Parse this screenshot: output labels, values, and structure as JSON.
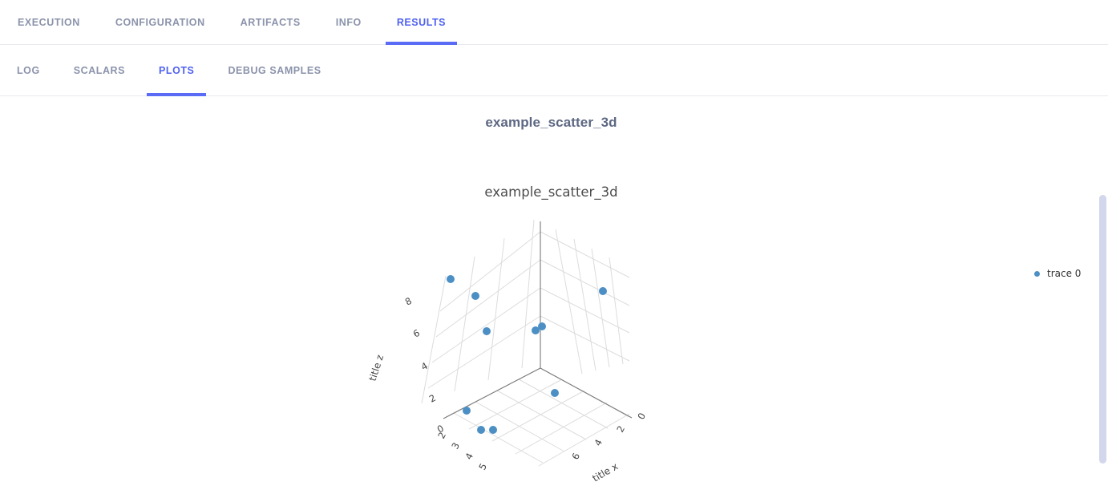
{
  "primary_tabs": [
    {
      "label": "EXECUTION",
      "active": false
    },
    {
      "label": "CONFIGURATION",
      "active": false
    },
    {
      "label": "ARTIFACTS",
      "active": false
    },
    {
      "label": "INFO",
      "active": false
    },
    {
      "label": "RESULTS",
      "active": true
    }
  ],
  "secondary_tabs": [
    {
      "label": "LOG",
      "active": false
    },
    {
      "label": "SCALARS",
      "active": false
    },
    {
      "label": "PLOTS",
      "active": true
    },
    {
      "label": "DEBUG SAMPLES",
      "active": false
    }
  ],
  "card": {
    "title": "example_scatter_3d"
  },
  "colors": {
    "accent": "#5a6cf5",
    "accent_text": "#4f61f0",
    "inactive_text": "#8b93ab",
    "card_title": "#5d6883",
    "marker": "#4b8fc4",
    "grid": "#d8d8d8",
    "axis_line": "#8d8d8d",
    "scrollbar_thumb": "#d2d7ec"
  },
  "chart_data": {
    "type": "scatter",
    "projection": "3d",
    "title": "example_scatter_3d",
    "xlabel": "title x",
    "ylabel": "",
    "zlabel": "title z",
    "axes": {
      "x": {
        "title": "title x",
        "ticks": [
          0,
          2,
          4,
          6
        ],
        "range": [
          0,
          7
        ]
      },
      "y": {
        "title": "",
        "ticks": [
          2,
          3,
          4,
          5
        ],
        "range": [
          1.5,
          5.5
        ]
      },
      "z": {
        "title": "title z",
        "ticks": [
          0,
          2,
          4,
          6,
          8
        ],
        "range": [
          0,
          9
        ]
      }
    },
    "grid": true,
    "legend": {
      "position": "right",
      "entries": [
        "trace 0"
      ]
    },
    "series": [
      {
        "name": "trace 0",
        "marker_color": "#4b8fc4",
        "points": [
          {
            "x": 1.0,
            "y": 2.0,
            "z": 8.6
          },
          {
            "x": 1.6,
            "y": 2.1,
            "z": 7.6
          },
          {
            "x": 2.2,
            "y": 2.3,
            "z": 6.0
          },
          {
            "x": 6.5,
            "y": 2.0,
            "z": 6.2
          },
          {
            "x": 6.1,
            "y": 2.1,
            "z": 6.4
          },
          {
            "x": 0.3,
            "y": 2.0,
            "z": 7.9
          },
          {
            "x": 4.8,
            "y": 4.2,
            "z": 0.1
          },
          {
            "x": 2.0,
            "y": 3.0,
            "z": 0.1
          },
          {
            "x": 2.6,
            "y": 4.4,
            "z": 0.1
          },
          {
            "x": 3.1,
            "y": 4.4,
            "z": 0.1
          }
        ]
      }
    ]
  },
  "legend": {
    "trace_label": "trace 0"
  },
  "scene_ticks": {
    "z": [
      "8",
      "6",
      "4",
      "2",
      "0"
    ],
    "y": [
      "2",
      "3",
      "4",
      "5"
    ],
    "x": [
      "0",
      "2",
      "4",
      "6"
    ],
    "z_title": "title z",
    "x_title": "title x"
  }
}
